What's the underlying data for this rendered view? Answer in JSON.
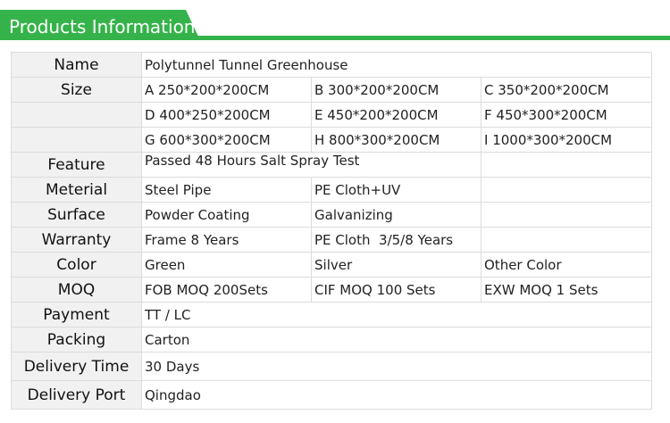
{
  "header": {
    "title": "Products Information",
    "accent_color": "#35b34a"
  },
  "table": {
    "rows": [
      {
        "label": "Name",
        "cells": [
          "Polytunnel Tunnel Greenhouse"
        ]
      },
      {
        "label": "Size",
        "cells": [
          "A 250*200*200CM",
          "B 300*200*200CM",
          "C 350*200*200CM"
        ]
      },
      {
        "label": "",
        "cells": [
          "D 400*250*200CM",
          "E 450*200*200CM",
          "F 450*300*200CM"
        ]
      },
      {
        "label": "",
        "cells": [
          "G 600*300*200CM",
          "H 800*300*200CM",
          "I 1000*300*200CM"
        ]
      },
      {
        "label": "Feature",
        "cells": [
          "Passed 48 Hours Salt Spray Test",
          ""
        ]
      },
      {
        "label": "Meterial",
        "cells": [
          "Steel Pipe",
          "PE Cloth+UV",
          ""
        ]
      },
      {
        "label": "Surface",
        "cells": [
          "Powder Coating",
          "Galvanizing",
          ""
        ]
      },
      {
        "label": "Warranty",
        "cells": [
          "Frame 8 Years",
          "PE Cloth  3/5/8 Years",
          ""
        ]
      },
      {
        "label": "Color",
        "cells": [
          "Green",
          "Silver",
          "Other Color"
        ]
      },
      {
        "label": "MOQ",
        "cells": [
          "FOB MOQ 200Sets",
          "CIF MOQ 100 Sets",
          "EXW MOQ 1 Sets"
        ]
      },
      {
        "label": "Payment",
        "cells": [
          "TT / LC"
        ]
      },
      {
        "label": "Packing",
        "cells": [
          "Carton"
        ]
      },
      {
        "label": "Delivery Time",
        "cells": [
          "30 Days"
        ]
      },
      {
        "label": "Delivery Port",
        "cells": [
          "Qingdao"
        ]
      }
    ]
  }
}
